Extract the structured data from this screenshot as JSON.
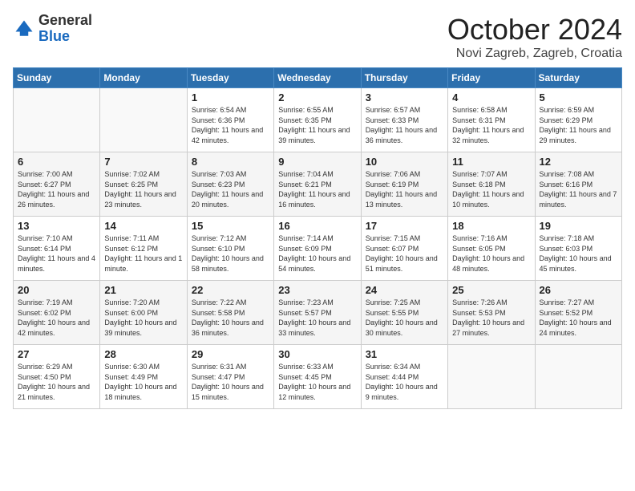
{
  "header": {
    "logo_general": "General",
    "logo_blue": "Blue",
    "month_title": "October 2024",
    "location": "Novi Zagreb, Zagreb, Croatia"
  },
  "days_of_week": [
    "Sunday",
    "Monday",
    "Tuesday",
    "Wednesday",
    "Thursday",
    "Friday",
    "Saturday"
  ],
  "weeks": [
    [
      {
        "day": "",
        "info": ""
      },
      {
        "day": "",
        "info": ""
      },
      {
        "day": "1",
        "info": "Sunrise: 6:54 AM\nSunset: 6:36 PM\nDaylight: 11 hours and 42 minutes."
      },
      {
        "day": "2",
        "info": "Sunrise: 6:55 AM\nSunset: 6:35 PM\nDaylight: 11 hours and 39 minutes."
      },
      {
        "day": "3",
        "info": "Sunrise: 6:57 AM\nSunset: 6:33 PM\nDaylight: 11 hours and 36 minutes."
      },
      {
        "day": "4",
        "info": "Sunrise: 6:58 AM\nSunset: 6:31 PM\nDaylight: 11 hours and 32 minutes."
      },
      {
        "day": "5",
        "info": "Sunrise: 6:59 AM\nSunset: 6:29 PM\nDaylight: 11 hours and 29 minutes."
      }
    ],
    [
      {
        "day": "6",
        "info": "Sunrise: 7:00 AM\nSunset: 6:27 PM\nDaylight: 11 hours and 26 minutes."
      },
      {
        "day": "7",
        "info": "Sunrise: 7:02 AM\nSunset: 6:25 PM\nDaylight: 11 hours and 23 minutes."
      },
      {
        "day": "8",
        "info": "Sunrise: 7:03 AM\nSunset: 6:23 PM\nDaylight: 11 hours and 20 minutes."
      },
      {
        "day": "9",
        "info": "Sunrise: 7:04 AM\nSunset: 6:21 PM\nDaylight: 11 hours and 16 minutes."
      },
      {
        "day": "10",
        "info": "Sunrise: 7:06 AM\nSunset: 6:19 PM\nDaylight: 11 hours and 13 minutes."
      },
      {
        "day": "11",
        "info": "Sunrise: 7:07 AM\nSunset: 6:18 PM\nDaylight: 11 hours and 10 minutes."
      },
      {
        "day": "12",
        "info": "Sunrise: 7:08 AM\nSunset: 6:16 PM\nDaylight: 11 hours and 7 minutes."
      }
    ],
    [
      {
        "day": "13",
        "info": "Sunrise: 7:10 AM\nSunset: 6:14 PM\nDaylight: 11 hours and 4 minutes."
      },
      {
        "day": "14",
        "info": "Sunrise: 7:11 AM\nSunset: 6:12 PM\nDaylight: 11 hours and 1 minute."
      },
      {
        "day": "15",
        "info": "Sunrise: 7:12 AM\nSunset: 6:10 PM\nDaylight: 10 hours and 58 minutes."
      },
      {
        "day": "16",
        "info": "Sunrise: 7:14 AM\nSunset: 6:09 PM\nDaylight: 10 hours and 54 minutes."
      },
      {
        "day": "17",
        "info": "Sunrise: 7:15 AM\nSunset: 6:07 PM\nDaylight: 10 hours and 51 minutes."
      },
      {
        "day": "18",
        "info": "Sunrise: 7:16 AM\nSunset: 6:05 PM\nDaylight: 10 hours and 48 minutes."
      },
      {
        "day": "19",
        "info": "Sunrise: 7:18 AM\nSunset: 6:03 PM\nDaylight: 10 hours and 45 minutes."
      }
    ],
    [
      {
        "day": "20",
        "info": "Sunrise: 7:19 AM\nSunset: 6:02 PM\nDaylight: 10 hours and 42 minutes."
      },
      {
        "day": "21",
        "info": "Sunrise: 7:20 AM\nSunset: 6:00 PM\nDaylight: 10 hours and 39 minutes."
      },
      {
        "day": "22",
        "info": "Sunrise: 7:22 AM\nSunset: 5:58 PM\nDaylight: 10 hours and 36 minutes."
      },
      {
        "day": "23",
        "info": "Sunrise: 7:23 AM\nSunset: 5:57 PM\nDaylight: 10 hours and 33 minutes."
      },
      {
        "day": "24",
        "info": "Sunrise: 7:25 AM\nSunset: 5:55 PM\nDaylight: 10 hours and 30 minutes."
      },
      {
        "day": "25",
        "info": "Sunrise: 7:26 AM\nSunset: 5:53 PM\nDaylight: 10 hours and 27 minutes."
      },
      {
        "day": "26",
        "info": "Sunrise: 7:27 AM\nSunset: 5:52 PM\nDaylight: 10 hours and 24 minutes."
      }
    ],
    [
      {
        "day": "27",
        "info": "Sunrise: 6:29 AM\nSunset: 4:50 PM\nDaylight: 10 hours and 21 minutes."
      },
      {
        "day": "28",
        "info": "Sunrise: 6:30 AM\nSunset: 4:49 PM\nDaylight: 10 hours and 18 minutes."
      },
      {
        "day": "29",
        "info": "Sunrise: 6:31 AM\nSunset: 4:47 PM\nDaylight: 10 hours and 15 minutes."
      },
      {
        "day": "30",
        "info": "Sunrise: 6:33 AM\nSunset: 4:45 PM\nDaylight: 10 hours and 12 minutes."
      },
      {
        "day": "31",
        "info": "Sunrise: 6:34 AM\nSunset: 4:44 PM\nDaylight: 10 hours and 9 minutes."
      },
      {
        "day": "",
        "info": ""
      },
      {
        "day": "",
        "info": ""
      }
    ]
  ]
}
